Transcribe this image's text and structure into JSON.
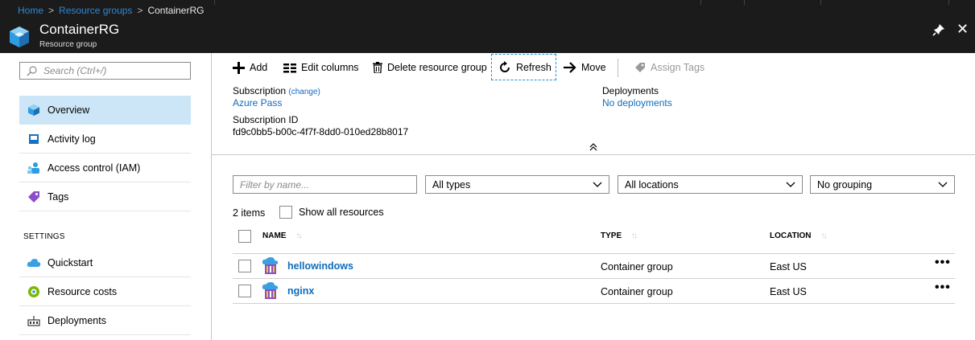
{
  "breadcrumb": {
    "home": "Home",
    "resource_groups": "Resource groups",
    "current": "ContainerRG",
    "separator": ">"
  },
  "blade": {
    "title": "ContainerRG",
    "subtitle": "Resource group",
    "close_glyph": "✕"
  },
  "sidebar": {
    "search_placeholder": "Search (Ctrl+/)",
    "items": [
      {
        "label": "Overview",
        "icon": "overview-icon",
        "active": true
      },
      {
        "label": "Activity log",
        "icon": "activity-log-icon"
      },
      {
        "label": "Access control (IAM)",
        "icon": "iam-icon"
      },
      {
        "label": "Tags",
        "icon": "tag-icon"
      }
    ],
    "settings_header": "SETTINGS",
    "settings_items": [
      {
        "label": "Quickstart",
        "icon": "quickstart-cloud-icon"
      },
      {
        "label": "Resource costs",
        "icon": "resource-costs-icon"
      },
      {
        "label": "Deployments",
        "icon": "deployments-icon"
      }
    ]
  },
  "toolbar": {
    "add": "Add",
    "edit_columns": "Edit columns",
    "delete_rg": "Delete resource group",
    "refresh": "Refresh",
    "move": "Move",
    "assign_tags": "Assign Tags"
  },
  "essentials": {
    "subscription_label": "Subscription",
    "subscription_change": "(change)",
    "subscription_value": "Azure Pass",
    "subscription_id_label": "Subscription ID",
    "subscription_id_value": "fd9c0bb5-b00c-4f7f-8dd0-010ed28b8017",
    "deployments_label": "Deployments",
    "deployments_value": "No deployments"
  },
  "filters": {
    "name_placeholder": "Filter by name...",
    "types": "All types",
    "locations": "All locations",
    "grouping": "No grouping"
  },
  "list": {
    "count": "2 items",
    "show_all": "Show all resources",
    "columns": {
      "name": "NAME",
      "type": "TYPE",
      "location": "LOCATION"
    },
    "rows": [
      {
        "name": "hellowindows",
        "type": "Container group",
        "location": "East US"
      },
      {
        "name": "nginx",
        "type": "Container group",
        "location": "East US"
      }
    ],
    "more_glyph": "•••"
  },
  "colors": {
    "accent": "#0f6cbd",
    "topbar": "#1b1b1b",
    "active_nav": "#cde6f7"
  }
}
